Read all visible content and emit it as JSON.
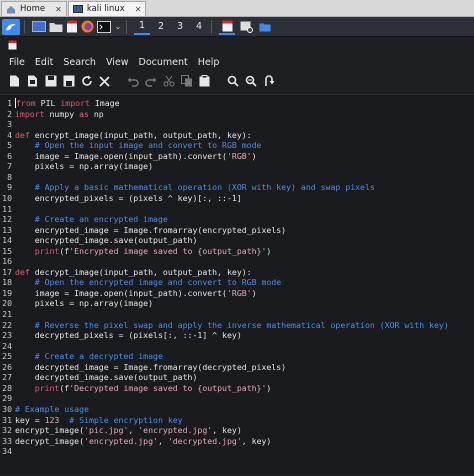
{
  "host_tabs": [
    {
      "label": "Home",
      "active": false
    },
    {
      "label": "kali linux",
      "active": true
    }
  ],
  "workspaces": [
    "1",
    "2",
    "3",
    "4"
  ],
  "active_workspace": "1",
  "menu": [
    "File",
    "Edit",
    "Search",
    "View",
    "Document",
    "Help"
  ],
  "colors": {
    "keyword": "#e05b6b",
    "comment": "#4f8de8",
    "string": "#e5a9b1",
    "text": "#e4e4e4",
    "accent": "#3f8cf0"
  },
  "code_lines": [
    [
      {
        "t": "from PIL import Image",
        "c": "kw-from"
      }
    ],
    [
      {
        "t": "import",
        "c": "kw"
      },
      {
        "t": " numpy ",
        "c": ""
      },
      {
        "t": "as",
        "c": "kw"
      },
      {
        "t": " np",
        "c": ""
      }
    ],
    [],
    [
      {
        "t": "def",
        "c": "kw"
      },
      {
        "t": " encrypt_image(input_path, output_path, key):",
        "c": ""
      }
    ],
    [
      {
        "t": "    # Open the input image and convert to RGB mode",
        "c": "cm"
      }
    ],
    [
      {
        "t": "    image = Image.open(input_path).convert(",
        "c": ""
      },
      {
        "t": "'RGB'",
        "c": "st"
      },
      {
        "t": ")",
        "c": ""
      }
    ],
    [
      {
        "t": "    pixels = np.array(image)",
        "c": ""
      }
    ],
    [],
    [
      {
        "t": "    # Apply a basic mathematical operation (XOR with key) and swap pixels",
        "c": "cm"
      }
    ],
    [
      {
        "t": "    encrypted_pixels = (pixels ^ key)[:, ::-1]",
        "c": ""
      }
    ],
    [],
    [
      {
        "t": "    # Create an encrypted image",
        "c": "cm"
      }
    ],
    [
      {
        "t": "    encrypted_image = Image.fromarray(encrypted_pixels)",
        "c": ""
      }
    ],
    [
      {
        "t": "    encrypted_image.save(output_path)",
        "c": ""
      }
    ],
    [
      {
        "t": "    ",
        "c": ""
      },
      {
        "t": "print",
        "c": "kw"
      },
      {
        "t": "(f",
        "c": ""
      },
      {
        "t": "'Encrypted image saved to {output_path}'",
        "c": "st"
      },
      {
        "t": ")",
        "c": ""
      }
    ],
    [],
    [
      {
        "t": "def",
        "c": "kw"
      },
      {
        "t": " decrypt_image(input_path, output_path, key):",
        "c": ""
      }
    ],
    [
      {
        "t": "    # Open the encrypted image and convert to RGB mode",
        "c": "cm"
      }
    ],
    [
      {
        "t": "    image = Image.open(input_path).convert(",
        "c": ""
      },
      {
        "t": "'RGB'",
        "c": "st"
      },
      {
        "t": ")",
        "c": ""
      }
    ],
    [
      {
        "t": "    pixels = np.array(image)",
        "c": ""
      }
    ],
    [],
    [
      {
        "t": "    # Reverse the pixel swap and apply the inverse mathematical operation (XOR with key)",
        "c": "cm"
      }
    ],
    [
      {
        "t": "    decrypted_pixels = (pixels[:, ::-1] ^ key)",
        "c": ""
      }
    ],
    [],
    [
      {
        "t": "    # Create a decrypted image",
        "c": "cm"
      }
    ],
    [
      {
        "t": "    decrypted_image = Image.fromarray(decrypted_pixels)",
        "c": ""
      }
    ],
    [
      {
        "t": "    decrypted_image.save(output_path)",
        "c": ""
      }
    ],
    [
      {
        "t": "    ",
        "c": ""
      },
      {
        "t": "print",
        "c": "kw"
      },
      {
        "t": "(f",
        "c": ""
      },
      {
        "t": "'Decrypted image saved to {output_path}'",
        "c": "st"
      },
      {
        "t": ")",
        "c": ""
      }
    ],
    [],
    [
      {
        "t": "# Example usage",
        "c": "cm"
      }
    ],
    [
      {
        "t": "key = ",
        "c": ""
      },
      {
        "t": "123",
        "c": "st"
      },
      {
        "t": "  ",
        "c": ""
      },
      {
        "t": "# Simple encryption key",
        "c": "cm"
      }
    ],
    [
      {
        "t": "encrypt_image(",
        "c": ""
      },
      {
        "t": "'pic.jpg'",
        "c": "st"
      },
      {
        "t": ", ",
        "c": ""
      },
      {
        "t": "'encrypted.jpg'",
        "c": "st"
      },
      {
        "t": ", key)",
        "c": ""
      }
    ],
    [
      {
        "t": "decrypt_image(",
        "c": ""
      },
      {
        "t": "'encrypted.jpg'",
        "c": "st"
      },
      {
        "t": ", ",
        "c": ""
      },
      {
        "t": "'decrypted.jpg'",
        "c": "st"
      },
      {
        "t": ", key)",
        "c": ""
      }
    ],
    []
  ],
  "toolbar_icons": [
    "new-file-icon",
    "new-window-icon",
    "save-icon",
    "save-as-icon",
    "reload-icon",
    "close-icon",
    "undo-icon",
    "redo-icon",
    "cut-icon",
    "copy-icon",
    "paste-icon",
    "find-icon",
    "find-replace-icon",
    "goto-icon"
  ]
}
